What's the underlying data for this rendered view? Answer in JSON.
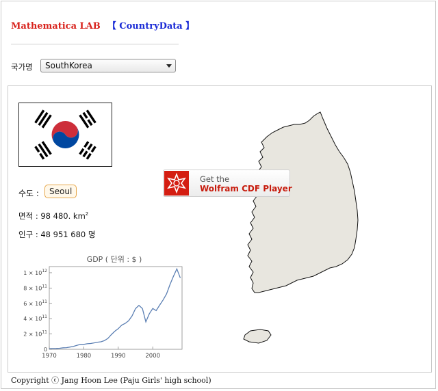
{
  "header": {
    "title_lab": "Mathematica LAB",
    "title_country_data": "【 CountryData 】"
  },
  "country_select": {
    "label": "국가명",
    "value": "SouthKorea"
  },
  "country_info": {
    "capital_label": "수도 :",
    "capital": "Seoul",
    "area_label": "면적 : ",
    "area_value": "98 480. km",
    "area_unit_exp": "2",
    "population_label": "인구 : ",
    "population_value": "48 951 680 명"
  },
  "cdf_badge": {
    "get_text": "Get the",
    "player_text": "Wolfram CDF Player"
  },
  "chart_data": {
    "type": "line",
    "title": "GDP ( 단위 : $ )",
    "xlabel": "",
    "ylabel": "",
    "xlim": [
      1970,
      2008.5
    ],
    "ylim": [
      0,
      1080000000000.0
    ],
    "x_ticks": [
      1970,
      1980,
      1990,
      2000
    ],
    "y_ticks": [
      {
        "value": 0,
        "label": "0"
      },
      {
        "value": 200000000000.0,
        "label": "2 × 10",
        "exp": "11"
      },
      {
        "value": 400000000000.0,
        "label": "4 × 10",
        "exp": "11"
      },
      {
        "value": 600000000000.0,
        "label": "6 × 10",
        "exp": "11"
      },
      {
        "value": 800000000000.0,
        "label": "8 × 10",
        "exp": "11"
      },
      {
        "value": 1000000000000.0,
        "label": "1 × 10",
        "exp": "12"
      }
    ],
    "series": [
      {
        "line_color": "#5b7fb3",
        "x": [
          1970,
          1971,
          1972,
          1973,
          1974,
          1975,
          1976,
          1977,
          1978,
          1979,
          1980,
          1981,
          1982,
          1983,
          1984,
          1985,
          1986,
          1987,
          1988,
          1989,
          1990,
          1991,
          1992,
          1993,
          1994,
          1995,
          1996,
          1997,
          1998,
          1999,
          2000,
          2001,
          2002,
          2003,
          2004,
          2005,
          2006,
          2007,
          2008
        ],
        "values": [
          8900000000.0,
          9800000000.0,
          10700000000.0,
          13600000000.0,
          19200000000.0,
          21400000000.0,
          29200000000.0,
          37900000000.0,
          51700000000.0,
          64000000000.0,
          64000000000.0,
          72000000000.0,
          76000000000.0,
          84000000000.0,
          93000000000.0,
          98000000000.0,
          113000000000.0,
          143000000000.0,
          192000000000.0,
          236000000000.0,
          270000000000.0,
          315000000000.0,
          338000000000.0,
          372000000000.0,
          435000000000.0,
          531000000000.0,
          573000000000.0,
          532000000000.0,
          358000000000.0,
          462000000000.0,
          533000000000.0,
          505000000000.0,
          576000000000.0,
          644000000000.0,
          722000000000.0,
          845000000000.0,
          952000000000.0,
          1050000000000.0,
          931000000000.0
        ]
      }
    ]
  }
}
